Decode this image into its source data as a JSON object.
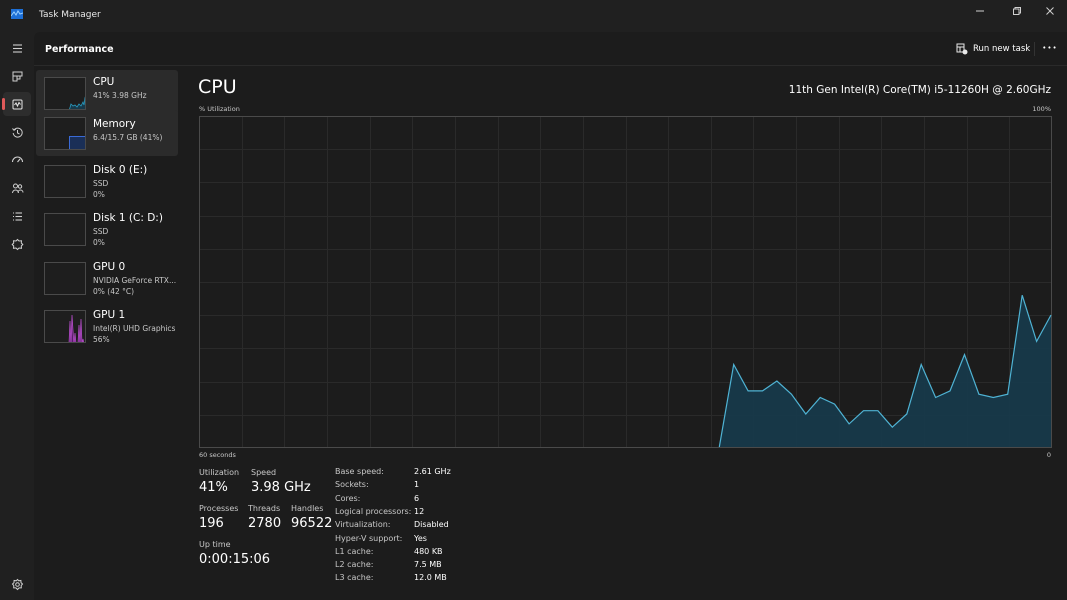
{
  "window": {
    "title": "Task Manager",
    "controls": {
      "minimize": "minimize-icon",
      "maximize": "restore-icon",
      "close": "close-icon"
    }
  },
  "nav_rail": {
    "items": [
      {
        "name": "menu",
        "icon": "hamburger-icon"
      },
      {
        "name": "processes",
        "icon": "processes-icon"
      },
      {
        "name": "performance",
        "icon": "performance-icon",
        "active": true
      },
      {
        "name": "app-history",
        "icon": "history-icon"
      },
      {
        "name": "startup-apps",
        "icon": "startup-icon"
      },
      {
        "name": "users",
        "icon": "users-icon"
      },
      {
        "name": "details",
        "icon": "details-icon"
      },
      {
        "name": "services",
        "icon": "services-icon"
      }
    ],
    "settings": {
      "icon": "gear-icon"
    },
    "accent": "#e05a5a"
  },
  "header": {
    "title": "Performance",
    "run_new_task": "Run new task",
    "more": "•••"
  },
  "devices": [
    {
      "name": "CPU",
      "line1": "41%  3.98 GHz",
      "line2": "",
      "selected": true,
      "color": "#2a9dc2"
    },
    {
      "name": "Memory",
      "line1": "6.4/15.7 GB (41%)",
      "line2": "",
      "selected": true,
      "color": "#1f4a8a",
      "fill_fraction": 0.41
    },
    {
      "name": "Disk 0 (E:)",
      "line1": "SSD",
      "line2": "0%",
      "selected": false
    },
    {
      "name": "Disk 1 (C: D:)",
      "line1": "SSD",
      "line2": "0%",
      "selected": false
    },
    {
      "name": "GPU 0",
      "line1": "NVIDIA GeForce RTX...",
      "line2": "0%  (42 °C)",
      "selected": false
    },
    {
      "name": "GPU 1",
      "line1": "Intel(R) UHD Graphics",
      "line2": "56%",
      "selected": false,
      "color": "#b44cc8"
    }
  ],
  "cpu": {
    "title": "CPU",
    "model": "11th Gen Intel(R) Core(TM) i5-11260H @ 2.60GHz",
    "stats": {
      "utilization_label": "Utilization",
      "utilization": "41%",
      "speed_label": "Speed",
      "speed": "3.98 GHz",
      "processes_label": "Processes",
      "processes": "196",
      "threads_label": "Threads",
      "threads": "2780",
      "handles_label": "Handles",
      "handles": "96522",
      "uptime_label": "Up time",
      "uptime": "0:00:15:06"
    },
    "specs": [
      {
        "label": "Base speed:",
        "value": "2.61 GHz"
      },
      {
        "label": "Sockets:",
        "value": "1"
      },
      {
        "label": "Cores:",
        "value": "6"
      },
      {
        "label": "Logical processors:",
        "value": "12"
      },
      {
        "label": "Virtualization:",
        "value": "Disabled"
      },
      {
        "label": "Hyper-V support:",
        "value": "Yes"
      },
      {
        "label": "L1 cache:",
        "value": "480 KB"
      },
      {
        "label": "L2 cache:",
        "value": "7.5 MB"
      },
      {
        "label": "L3 cache:",
        "value": "12.0 MB"
      }
    ]
  },
  "chart_data": {
    "type": "area",
    "title": "CPU",
    "ylabel": "% Utilization",
    "ymax_label": "100%",
    "xlabel_left": "60 seconds",
    "xlabel_right": "0",
    "ylim": [
      0,
      100
    ],
    "xlim": [
      60,
      0
    ],
    "grid": true,
    "grid_rows": 10,
    "grid_cols": 20,
    "line_color": "#4fb3d4",
    "fill_color": "#17394a",
    "series": [
      {
        "name": "CPU utilization",
        "values": [
          0,
          0,
          0,
          0,
          0,
          0,
          0,
          0,
          0,
          0,
          0,
          0,
          0,
          0,
          0,
          0,
          0,
          0,
          0,
          0,
          0,
          0,
          0,
          0,
          0,
          0,
          0,
          0,
          0,
          0,
          0,
          0,
          0,
          0,
          0,
          0,
          0,
          25,
          17,
          17,
          20,
          16,
          10,
          15,
          13,
          7,
          11,
          11,
          6,
          10,
          25,
          15,
          17,
          28,
          16,
          15,
          16,
          46,
          32,
          40
        ]
      }
    ]
  }
}
